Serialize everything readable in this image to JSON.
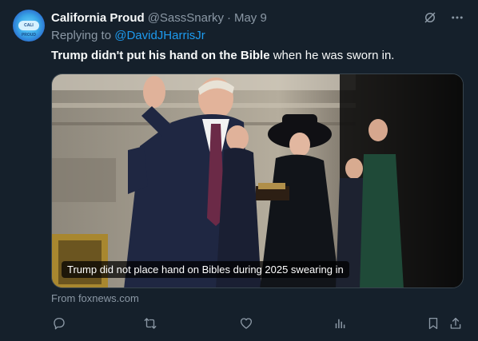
{
  "author": {
    "display_name": "California Proud",
    "handle": "@SassSnarky",
    "separator": "·",
    "date": "May 9",
    "avatar_text": "CALI PROUD"
  },
  "reply": {
    "prefix": "Replying to",
    "mention": "@DavidJHarrisJr"
  },
  "tweet": {
    "text_bold": "Trump didn't put his hand on the Bible",
    "text_rest": " when he was sworn in."
  },
  "media": {
    "caption": "Trump did not place hand on Bibles during 2025 swearing in"
  },
  "link": {
    "source": "From foxnews.com"
  },
  "icons": {
    "grok": "grok-icon",
    "more": "more-icon",
    "reply": "reply-icon",
    "repost": "repost-icon",
    "like": "like-icon",
    "views": "views-icon",
    "bookmark": "bookmark-icon",
    "share": "share-icon"
  },
  "colors": {
    "background": "#15202b",
    "accent": "#1d9bf0",
    "muted": "#8b98a5",
    "text": "#f7f9f9"
  }
}
